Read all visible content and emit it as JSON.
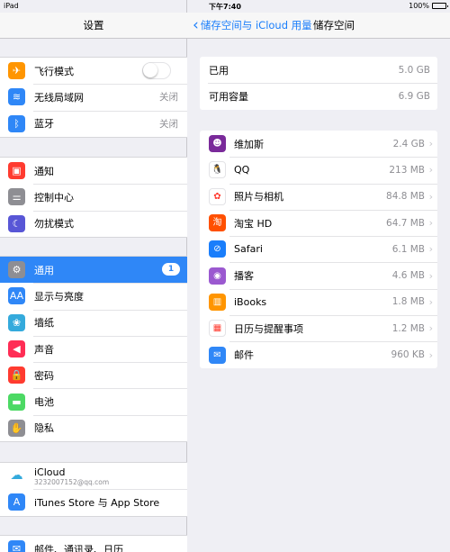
{
  "status_bar": {
    "device": "iPad",
    "time": "下午7:40",
    "battery_text": "100%",
    "battery_level": 1.0
  },
  "left": {
    "title": "设置",
    "groups": [
      [
        {
          "label": "飞行模式",
          "icon": "airplane-icon",
          "color": "#ff9500",
          "glyph": "✈",
          "toggle_on": false
        },
        {
          "label": "无线局域网",
          "icon": "wifi-icon",
          "color": "#2f87f7",
          "glyph": "≋",
          "value": "关闭"
        },
        {
          "label": "蓝牙",
          "icon": "bluetooth-icon",
          "color": "#2f87f7",
          "glyph": "ᛒ",
          "value": "关闭"
        }
      ],
      [
        {
          "label": "通知",
          "icon": "notifications-icon",
          "color": "#ff3b30",
          "glyph": "▣"
        },
        {
          "label": "控制中心",
          "icon": "control-center-icon",
          "color": "#8e8e93",
          "glyph": "⚌"
        },
        {
          "label": "勿扰模式",
          "icon": "do-not-disturb-icon",
          "color": "#5856d6",
          "glyph": "☾"
        }
      ],
      [
        {
          "label": "通用",
          "icon": "gear-icon",
          "color": "#8e8e93",
          "glyph": "⚙",
          "badge": "1",
          "selected": true
        },
        {
          "label": "显示与亮度",
          "icon": "display-icon",
          "color": "#2f87f7",
          "glyph": "AA"
        },
        {
          "label": "墙纸",
          "icon": "wallpaper-icon",
          "color": "#34aadc",
          "glyph": "❀"
        },
        {
          "label": "声音",
          "icon": "sound-icon",
          "color": "#ff2d55",
          "glyph": "◀"
        },
        {
          "label": "密码",
          "icon": "passcode-icon",
          "color": "#ff3b30",
          "glyph": "🔒"
        },
        {
          "label": "电池",
          "icon": "battery-icon",
          "color": "#4cd964",
          "glyph": "▬"
        },
        {
          "label": "隐私",
          "icon": "privacy-icon",
          "color": "#8e8e93",
          "glyph": "✋"
        }
      ],
      [
        {
          "label": "iCloud",
          "sub": "3232007152@qq.com",
          "icon": "icloud-icon",
          "color": "#ffffff",
          "glyph": "☁"
        },
        {
          "label": "iTunes Store 与 App Store",
          "icon": "app-store-icon",
          "color": "#2f87f7",
          "glyph": "A"
        }
      ],
      [
        {
          "label": "邮件、通讯录、日历",
          "icon": "mail-icon",
          "color": "#2f87f7",
          "glyph": "✉"
        }
      ]
    ]
  },
  "right": {
    "back_label": "储存空间与 iCloud 用量",
    "title": "储存空间",
    "usage": [
      {
        "label": "已用",
        "value": "5.0 GB"
      },
      {
        "label": "可用容量",
        "value": "6.9 GB"
      }
    ],
    "apps": [
      {
        "name": "维加斯",
        "size": "2.4 GB",
        "icon": "vegas-game-icon",
        "color": "#7a2a9a",
        "glyph": "☻"
      },
      {
        "name": "QQ",
        "size": "213 MB",
        "icon": "qq-penguin-icon",
        "color": "#ffffff",
        "glyph": "🐧"
      },
      {
        "name": "照片与相机",
        "size": "84.8 MB",
        "icon": "photos-icon",
        "color": "#ffffff",
        "glyph": "✿"
      },
      {
        "name": "淘宝 HD",
        "size": "64.7 MB",
        "icon": "taobao-icon",
        "color": "#ff5000",
        "glyph": "淘"
      },
      {
        "name": "Safari",
        "size": "6.1 MB",
        "icon": "safari-compass-icon",
        "color": "#1a7efb",
        "glyph": "⊘"
      },
      {
        "name": "播客",
        "size": "4.6 MB",
        "icon": "podcasts-icon",
        "color": "#9b59d0",
        "glyph": "◉"
      },
      {
        "name": "iBooks",
        "size": "1.8 MB",
        "icon": "ibooks-icon",
        "color": "#ff9500",
        "glyph": "▥"
      },
      {
        "name": "日历与提醒事项",
        "size": "1.2 MB",
        "icon": "calendar-icon",
        "color": "#ffffff",
        "glyph": "▦"
      },
      {
        "name": "邮件",
        "size": "960 KB",
        "icon": "mail-icon",
        "color": "#2f87f7",
        "glyph": "✉"
      }
    ]
  }
}
